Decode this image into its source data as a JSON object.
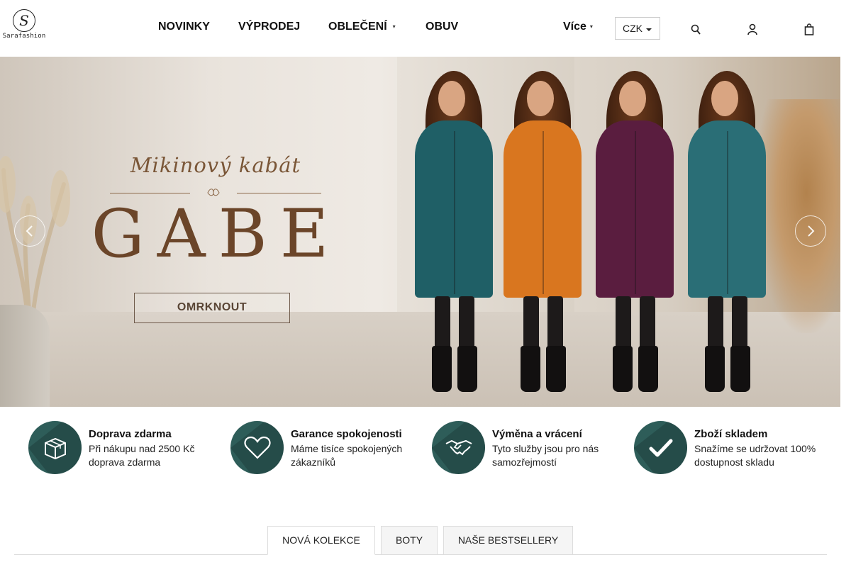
{
  "brand": {
    "logo_text": "Sarafashion",
    "logo_letter": "S"
  },
  "nav": {
    "items": [
      {
        "label": "NOVINKY"
      },
      {
        "label": "VÝPRODEJ"
      },
      {
        "label": "OBLEČENÍ",
        "has_dropdown": true
      },
      {
        "label": "OBUV"
      }
    ],
    "more_label": "Více",
    "currency": "CZK",
    "icons": [
      "search-icon",
      "user-icon",
      "cart-icon"
    ]
  },
  "hero": {
    "subtitle": "Mikinový kabát",
    "title": "GABE",
    "button_label": "OMRKNOUT",
    "coat_colors": [
      "#1f5f66",
      "#d9761f",
      "#5a1d3f",
      "#2a6e76"
    ],
    "prev_icon": "chevron-left-icon",
    "next_icon": "chevron-right-icon"
  },
  "features": [
    {
      "icon": "box-icon",
      "title": "Doprava zdarma",
      "text": "Při nákupu nad 2500 Kč doprava zdarma"
    },
    {
      "icon": "heart-icon",
      "title": "Garance spokojenosti",
      "text": "Máme tisíce spokojených zákazníků"
    },
    {
      "icon": "handshake-icon",
      "title": "Výměna a vrácení",
      "text": "Tyto služby jsou pro nás samozřejmostí"
    },
    {
      "icon": "check-icon",
      "title": "Zboží skladem",
      "text": "Snažíme se udržovat 100% dostupnost skladu"
    }
  ],
  "tabs": [
    {
      "label": "NOVÁ KOLEKCE",
      "active": true
    },
    {
      "label": "BOTY",
      "active": false
    },
    {
      "label": "NAŠE BESTSELLERY",
      "active": false
    }
  ],
  "colors": {
    "accent": "#2e5d59",
    "hero_text": "#6b4529"
  }
}
